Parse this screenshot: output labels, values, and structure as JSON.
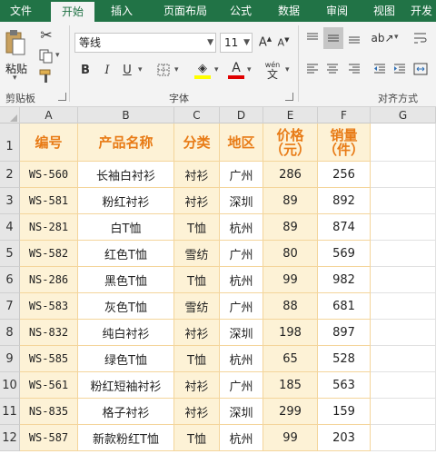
{
  "ribbon": {
    "tabs": [
      "文件",
      "开始",
      "插入",
      "页面布局",
      "公式",
      "数据",
      "审阅",
      "视图",
      "开发"
    ],
    "active_tab_index": 1,
    "clipboard": {
      "paste_label": "粘贴",
      "group_label": "剪贴板"
    },
    "font": {
      "name": "等线",
      "size": "11",
      "group_label": "字体",
      "phonetic_label": "wén"
    },
    "alignment": {
      "group_label": "对齐方式"
    },
    "colors": {
      "tab_bar": "#217346",
      "header_text": "#e87b16",
      "band_yellow": "#fdf2d6",
      "grid_line": "#f4d59b",
      "highlight_yellow": "#ffff00",
      "font_red": "#e00000"
    }
  },
  "sheet": {
    "columns": [
      "A",
      "B",
      "C",
      "D",
      "E",
      "F",
      "G"
    ],
    "row_numbers": [
      "1",
      "2",
      "3",
      "4",
      "5",
      "6",
      "7",
      "8",
      "9",
      "10",
      "11",
      "12"
    ],
    "header": {
      "code": "编号",
      "name": "产品名称",
      "category": "分类",
      "region": "地区",
      "price_line1": "价格",
      "price_line2": "（元）",
      "qty_line1": "销量",
      "qty_line2": "（件）"
    },
    "rows": [
      {
        "code": "WS-560",
        "name": "长袖白衬衫",
        "category": "衬衫",
        "region": "广州",
        "price": "286",
        "qty": "256"
      },
      {
        "code": "WS-581",
        "name": "粉红衬衫",
        "category": "衬衫",
        "region": "深圳",
        "price": "89",
        "qty": "892"
      },
      {
        "code": "NS-281",
        "name": "白T恤",
        "category": "T恤",
        "region": "杭州",
        "price": "89",
        "qty": "874"
      },
      {
        "code": "WS-582",
        "name": "红色T恤",
        "category": "雪纺",
        "region": "广州",
        "price": "80",
        "qty": "569"
      },
      {
        "code": "NS-286",
        "name": "黑色T恤",
        "category": "T恤",
        "region": "杭州",
        "price": "99",
        "qty": "982"
      },
      {
        "code": "WS-583",
        "name": "灰色T恤",
        "category": "雪纺",
        "region": "广州",
        "price": "88",
        "qty": "681"
      },
      {
        "code": "NS-832",
        "name": "纯白衬衫",
        "category": "衬衫",
        "region": "深圳",
        "price": "198",
        "qty": "897"
      },
      {
        "code": "WS-585",
        "name": "绿色T恤",
        "category": "T恤",
        "region": "杭州",
        "price": "65",
        "qty": "528"
      },
      {
        "code": "WS-561",
        "name": "粉红短袖衬衫",
        "category": "衬衫",
        "region": "广州",
        "price": "185",
        "qty": "563"
      },
      {
        "code": "NS-835",
        "name": "格子衬衫",
        "category": "衬衫",
        "region": "深圳",
        "price": "299",
        "qty": "159"
      },
      {
        "code": "WS-587",
        "name": "新款粉红T恤",
        "category": "T恤",
        "region": "杭州",
        "price": "99",
        "qty": "203"
      }
    ]
  }
}
